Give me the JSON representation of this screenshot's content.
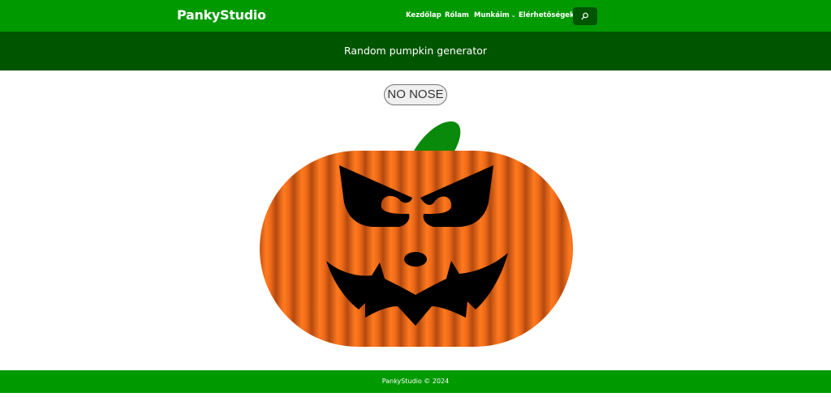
{
  "header": {
    "brand": "PankyStudio",
    "nav": [
      {
        "label": "Kezdőlap"
      },
      {
        "label": "Rólam"
      },
      {
        "label": "Munkáim"
      },
      {
        "label": "Elérhetőségek"
      }
    ],
    "chevron": "⌄"
  },
  "page": {
    "title": "Random pumpkin generator"
  },
  "controls": {
    "nose_button_label": "NO NOSE"
  },
  "pumpkin": {
    "body_color": "#ef6f1c",
    "stripe_dark": "#b54a10",
    "stem_color": "#0a8a0a",
    "face_color": "#000000"
  },
  "footer": {
    "text": "PankyStudio © 2024"
  },
  "colors": {
    "header_green": "#009900",
    "title_green": "#005500"
  }
}
